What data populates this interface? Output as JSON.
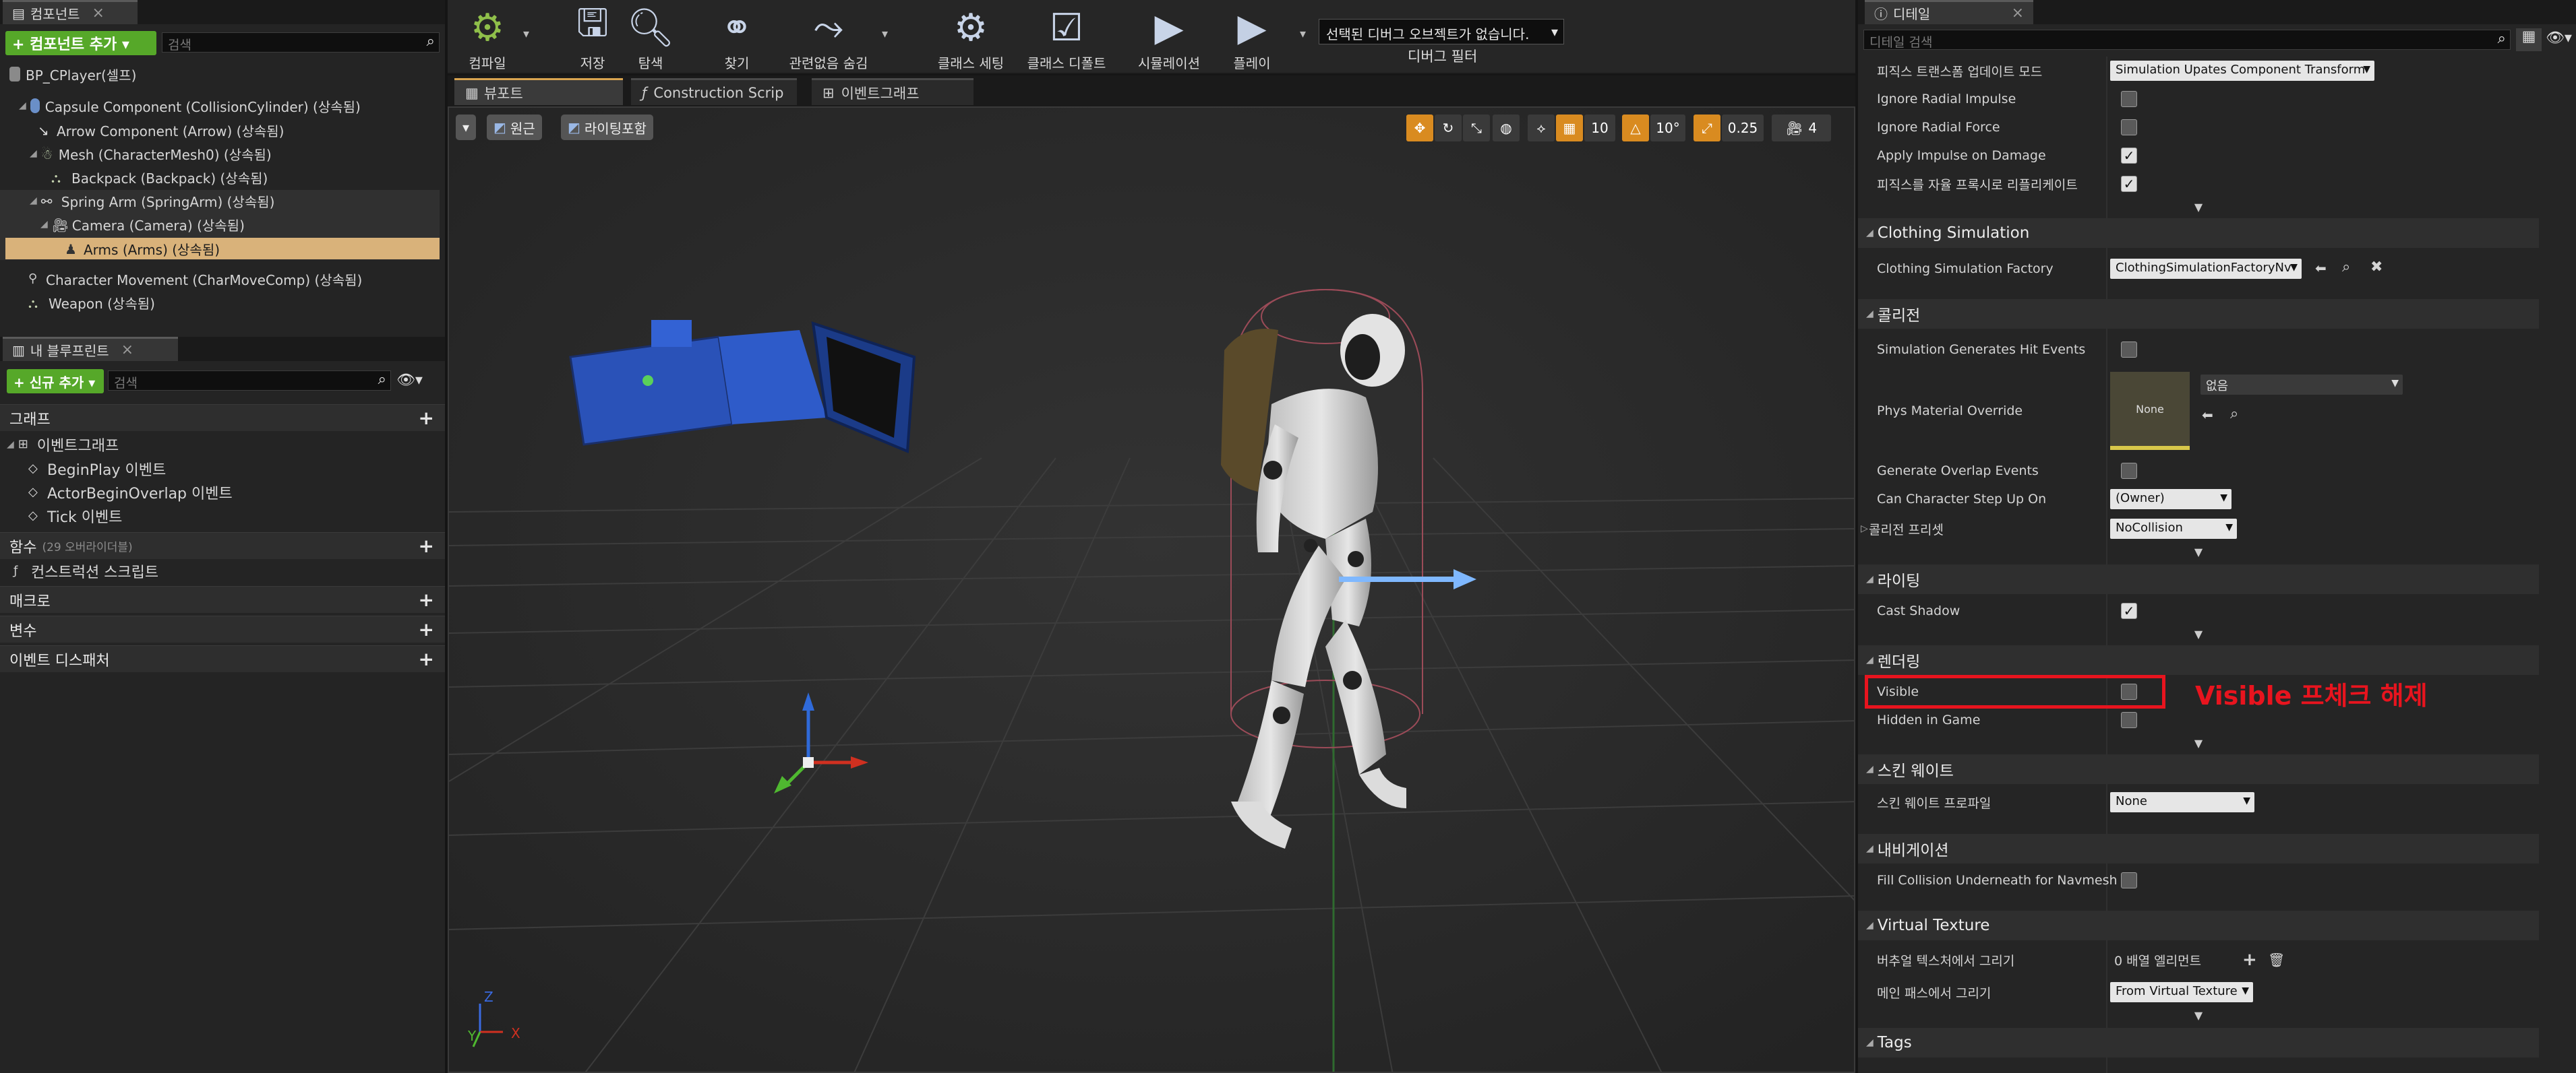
{
  "components": {
    "tab": "컴포넌트",
    "add_button": "+ 컴포넌트 추가 ▾",
    "search_placeholder": "검색",
    "root": "BP_CPlayer(셀프)",
    "items": [
      "Capsule Component (CollisionCylinder) (상속됨)",
      "Arrow Component (Arrow) (상속됨)",
      "Mesh (CharacterMesh0) (상속됨)",
      "Backpack (Backpack) (상속됨)",
      "Spring Arm (SpringArm) (상속됨)",
      "Camera (Camera) (상속됨)",
      "Arms (Arms) (상속됨)",
      "Character Movement (CharMoveComp) (상속됨)",
      "Weapon (상속됨)"
    ]
  },
  "blueprint": {
    "tab": "내 블루프린트",
    "add_button": "+ 신규 추가 ▾",
    "search_placeholder": "검색",
    "graph_section": "그래프",
    "event_graph": "이벤트그래프",
    "events": [
      "BeginPlay 이벤트",
      "ActorBeginOverlap 이벤트",
      "Tick 이벤트"
    ],
    "functions_section": "함수",
    "functions_note": "(29 오버라이더블)",
    "construction_script": "컨스트럭션 스크립트",
    "macros_section": "매크로",
    "variables_section": "변수",
    "dispatchers_section": "이벤트 디스패처"
  },
  "toolbar": {
    "compile": "컴파일",
    "save": "저장",
    "browse": "탐색",
    "find": "찾기",
    "hide_unrelated": "관련없음 숨김",
    "class_settings": "클래스 세팅",
    "class_defaults": "클래스 디폴트",
    "simulation": "시뮬레이션",
    "play": "플레이",
    "debug_select": "선택된 디버그 오브젝트가 없습니다.",
    "debug_filter": "디버그 필터"
  },
  "editor_tabs": [
    "뷰포트",
    "Construction Scrip",
    "이벤트그래프"
  ],
  "viewport": {
    "perspective": "원근",
    "lighting": "라이팅포함",
    "grid_snap": "10",
    "rotation_snap": "10°",
    "scale_snap": "0.25",
    "camera_speed": "4",
    "axis_labels": [
      "Z",
      "Y",
      "X"
    ]
  },
  "details": {
    "tab": "디테일",
    "search_placeholder": "디테일 검색",
    "physics_update_label": "피직스 트랜스폼 업데이트 모드",
    "physics_update_value": "Simulation Upates Component Transform",
    "ignore_radial_impulse": "Ignore Radial Impulse",
    "ignore_radial_force": "Ignore Radial Force",
    "apply_impulse_on_damage": "Apply Impulse on Damage",
    "replicate_physics": "피직스를 자율 프록시로 리플리케이트",
    "clothing_section": "Clothing Simulation",
    "clothing_factory": "Clothing Simulation Factory",
    "clothing_factory_value": "ClothingSimulationFactoryNv",
    "collision_section": "콜리전",
    "sim_hit_events": "Simulation Generates Hit Events",
    "phys_material": "Phys Material Override",
    "phys_material_thumb": "None",
    "phys_material_value": "없음",
    "overlap_events": "Generate Overlap Events",
    "step_up": "Can Character Step Up On",
    "step_up_value": "(Owner)",
    "collision_preset": "콜리전 프리셋",
    "collision_preset_value": "NoCollision",
    "lighting_section": "라이팅",
    "cast_shadow": "Cast Shadow",
    "rendering_section": "렌더링",
    "visible": "Visible",
    "hidden_in_game": "Hidden in Game",
    "annotation": "Visible 프체크 해제",
    "skin_weight_section": "스킨 웨이트",
    "skin_weight_profile": "스킨 웨이트 프로파일",
    "skin_weight_value": "None",
    "navigation_section": "내비게이션",
    "fill_collision": "Fill Collision Underneath for Navmesh",
    "vt_section": "Virtual Texture",
    "vt_draw": "버추얼 텍스처에서 그리기",
    "vt_draw_value": "0 배열 엘리먼트",
    "main_pass": "메인 패스에서 그리기",
    "main_pass_value": "From Virtual Texture",
    "tags_section": "Tags"
  },
  "colors": {
    "accent_green": "#56a829",
    "selected_row": "#d9b27a",
    "annotation_red": "#e8141e",
    "panel_bg": "#242424",
    "viewport_bg": "#2b2b2b"
  }
}
